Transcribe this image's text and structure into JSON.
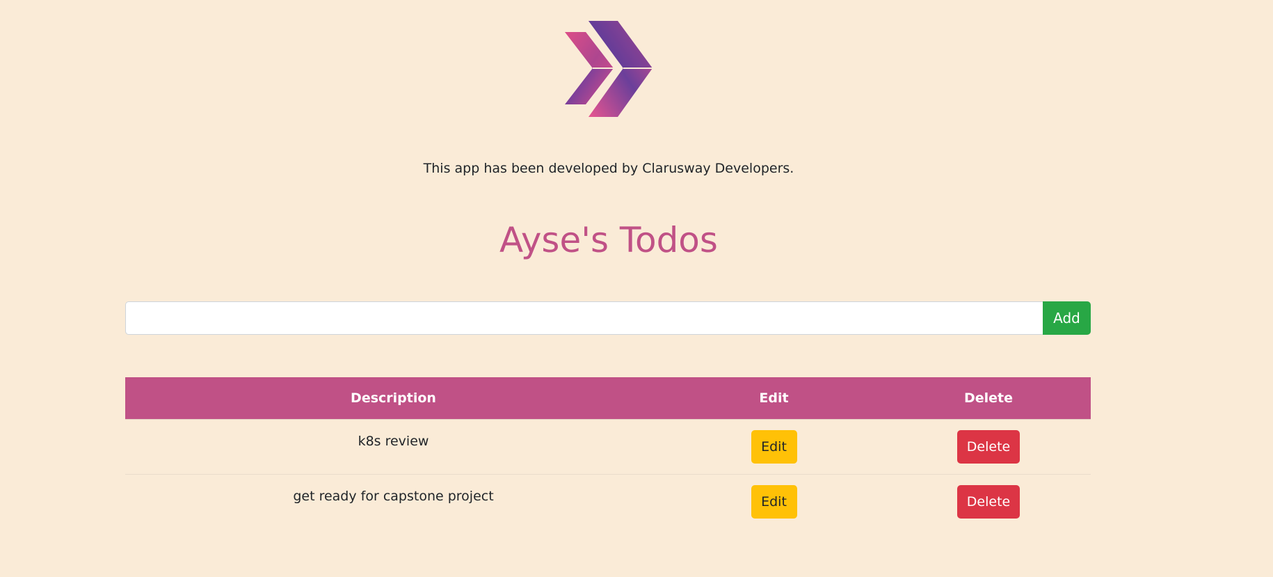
{
  "app": {
    "logo_icon": "clarusway-chevron-logo",
    "credit_text": "This app has been developed by Clarusway Developers.",
    "title": "Ayse's Todos"
  },
  "add_form": {
    "input_value": "",
    "input_placeholder": "",
    "add_label": "Add"
  },
  "table": {
    "headers": {
      "description": "Description",
      "edit": "Edit",
      "delete": "Delete"
    },
    "rows": [
      {
        "description": "k8s review",
        "edit_label": "Edit",
        "delete_label": "Delete"
      },
      {
        "description": "get ready for capstone project",
        "edit_label": "Edit",
        "delete_label": "Delete"
      }
    ]
  },
  "colors": {
    "background": "#faebd7",
    "accent": "#c05186",
    "add_button": "#28a745",
    "edit_button": "#ffc107",
    "delete_button": "#dc3545"
  }
}
